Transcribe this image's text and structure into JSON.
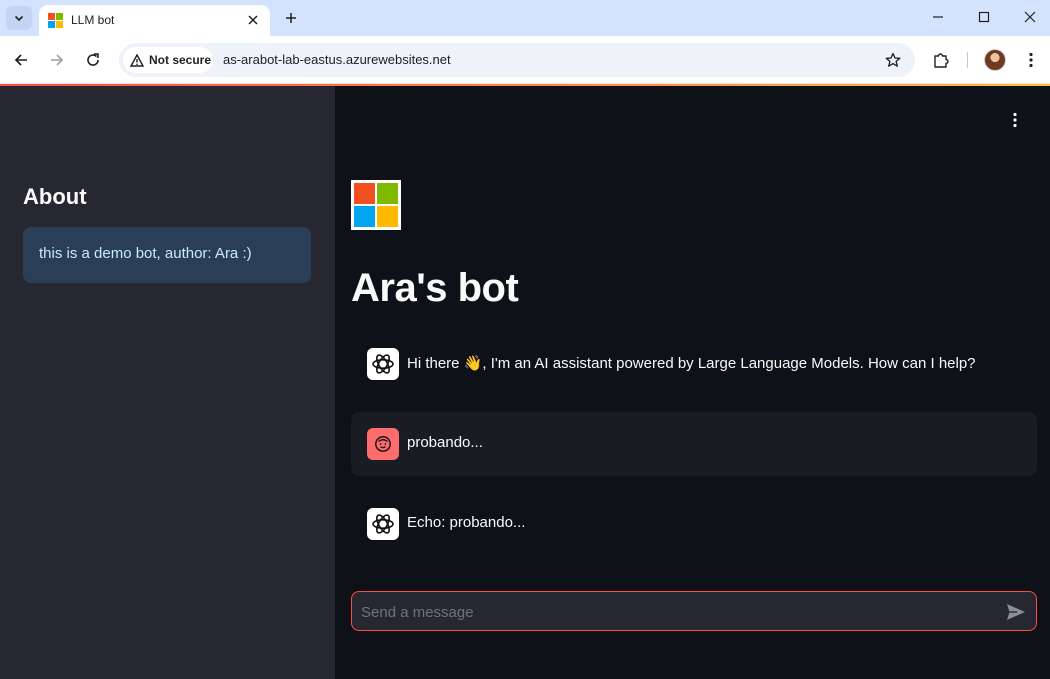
{
  "browser": {
    "tab_title": "LLM bot",
    "security_label": "Not secure",
    "url": "as-arabot-lab-eastus.azurewebsites.net"
  },
  "sidebar": {
    "title": "About",
    "info": "this is a demo bot, author: Ara :)"
  },
  "main": {
    "title": "Ara's bot",
    "messages": [
      {
        "role": "assistant",
        "text": "Hi there 👋, I'm an AI assistant powered by Large Language Models. How can I help?"
      },
      {
        "role": "user",
        "text": "probando..."
      },
      {
        "role": "assistant",
        "text": "Echo: probando..."
      }
    ],
    "input_placeholder": "Send a message",
    "input_value": ""
  },
  "colors": {
    "accent": "#ff4b4b",
    "sidebar_bg": "#262730",
    "main_bg": "#0e1117",
    "info_box_bg": "#2b3e57",
    "user_avatar": "#ff6c6c"
  },
  "icons": {
    "tab_search": "chevron-down-icon",
    "favicon": "microsoft-logo-icon",
    "tab_close": "close-icon",
    "new_tab": "plus-icon",
    "back": "arrow-left-icon",
    "forward": "arrow-right-icon",
    "reload": "reload-icon",
    "security": "warning-triangle-icon",
    "bookmark": "star-icon",
    "extensions": "puzzle-icon",
    "browser_menu": "kebab-menu-icon",
    "app_menu": "kebab-menu-icon",
    "assistant_avatar": "openai-logo-icon",
    "user_avatar": "smiley-face-icon",
    "send": "send-icon"
  }
}
